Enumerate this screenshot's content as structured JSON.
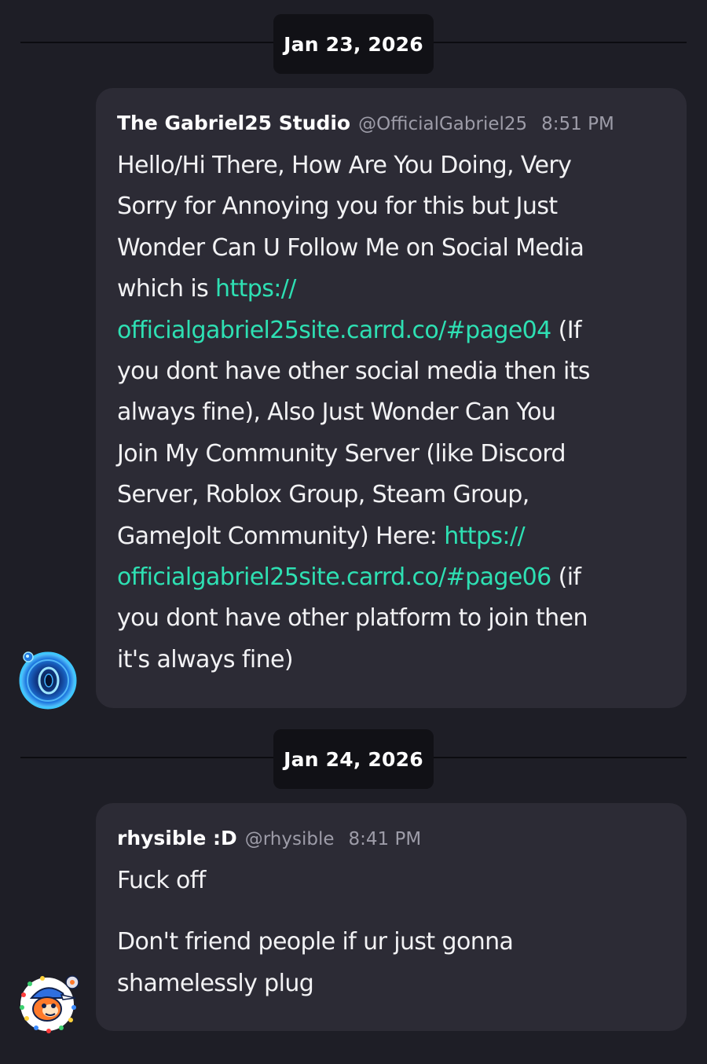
{
  "messages": [
    {
      "date_separator": "Jan 23, 2026",
      "display_name": "The Gabriel25 Studio",
      "handle": "@OfficialGabriel25",
      "time": "8:51 PM",
      "lines": [
        [
          {
            "t": "Hello/Hi There, How Are You Doing, Very"
          }
        ],
        [
          {
            "t": "Sorry for Annoying you for this but Just"
          }
        ],
        [
          {
            "t": "Wonder Can U Follow Me on Social Media"
          }
        ],
        [
          {
            "t": "which is "
          },
          {
            "t": "https://",
            "link": true
          }
        ],
        [
          {
            "t": "officialgabriel25site.carrd.co/#page04",
            "link": true
          },
          {
            "t": " (If"
          }
        ],
        [
          {
            "t": "you dont have other social media then its"
          }
        ],
        [
          {
            "t": "always fine), Also Just Wonder Can You"
          }
        ],
        [
          {
            "t": "Join My Community Server (like Discord"
          }
        ],
        [
          {
            "t": "Server, Roblox Group, Steam Group,"
          }
        ],
        [
          {
            "t": "GameJolt Community) Here: "
          },
          {
            "t": "https://",
            "link": true
          }
        ],
        [
          {
            "t": "officialgabriel25site.carrd.co/#page06",
            "link": true
          },
          {
            "t": " (if"
          }
        ],
        [
          {
            "t": "you dont have other platform to join then"
          }
        ],
        [
          {
            "t": "it's always fine)"
          }
        ]
      ]
    },
    {
      "date_separator": "Jan 24, 2026",
      "display_name": "rhysible :D",
      "handle": "@rhysible",
      "time": "8:41 PM",
      "paragraphs": [
        [
          "Fuck off"
        ],
        [
          "Don't friend people if ur just gonna",
          "shamelessly plug"
        ]
      ]
    }
  ],
  "icons": {
    "avatar_1": "blue-portal-avatar-icon",
    "avatar_2": "cartoon-character-avatar-icon"
  },
  "colors": {
    "background": "#1e1e26",
    "bubble": "#2c2b35",
    "link": "#2ee0b3",
    "muted": "#9d9ca8"
  }
}
